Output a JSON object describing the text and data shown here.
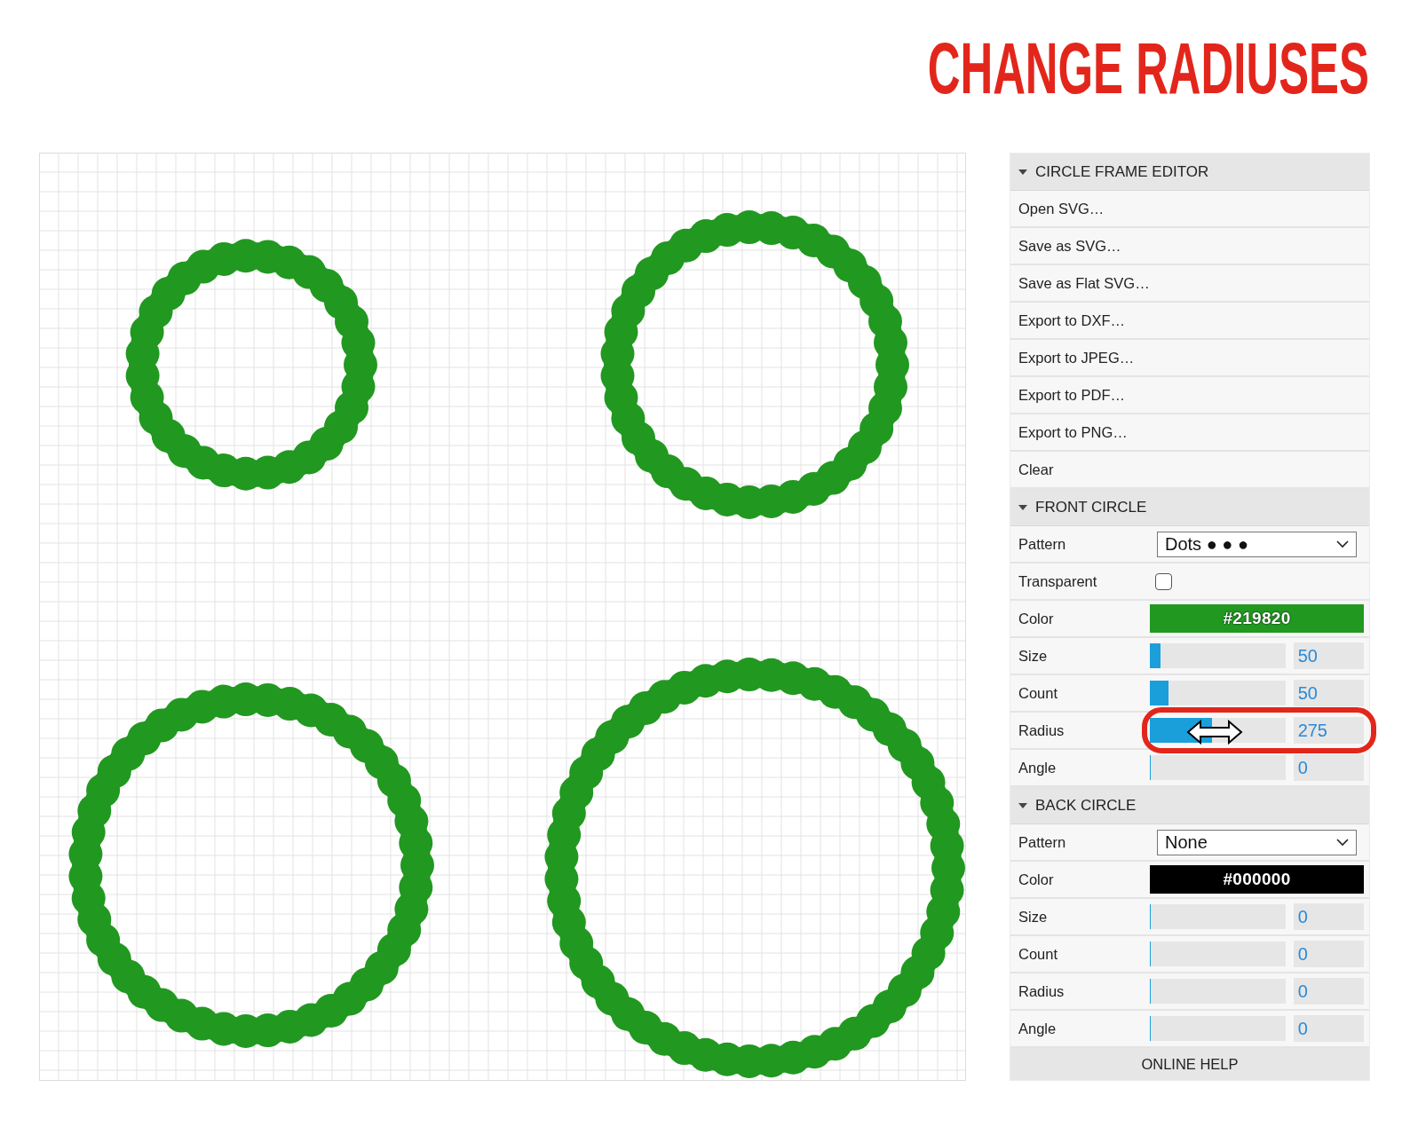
{
  "heading": "CHANGE RADIUSES",
  "sections": [
    {
      "title": "CIRCLE FRAME EDITOR",
      "expanded": true,
      "rows": [
        {
          "kind": "action",
          "label": "Open SVG…"
        },
        {
          "kind": "action",
          "label": "Save as SVG…"
        },
        {
          "kind": "action",
          "label": "Save as Flat SVG…"
        },
        {
          "kind": "action",
          "label": "Export to DXF…"
        },
        {
          "kind": "action",
          "label": "Export to JPEG…"
        },
        {
          "kind": "action",
          "label": "Export to PDF…"
        },
        {
          "kind": "action",
          "label": "Export to PNG…"
        },
        {
          "kind": "action",
          "label": "Clear"
        }
      ]
    },
    {
      "title": "FRONT CIRCLE",
      "expanded": true,
      "rows": [
        {
          "kind": "select",
          "label": "Pattern",
          "value": "Dots ● ● ●"
        },
        {
          "kind": "checkbox",
          "label": "Transparent",
          "checked": false
        },
        {
          "kind": "color",
          "label": "Color",
          "value": "#219820",
          "color": "#219820"
        },
        {
          "kind": "slider",
          "label": "Size",
          "level": 0.08,
          "value": "50",
          "highlighted": false
        },
        {
          "kind": "slider",
          "label": "Count",
          "level": 0.14,
          "value": "50",
          "highlighted": false
        },
        {
          "kind": "slider",
          "label": "Radius",
          "level": 0.46,
          "value": "275",
          "highlighted": true
        },
        {
          "kind": "slider",
          "label": "Angle",
          "level": 0,
          "value": "0",
          "highlighted": false
        }
      ]
    },
    {
      "title": "BACK CIRCLE",
      "expanded": true,
      "rows": [
        {
          "kind": "select",
          "label": "Pattern",
          "value": "None"
        },
        {
          "kind": "color",
          "label": "Color",
          "value": "#000000",
          "color": "#000000"
        },
        {
          "kind": "slider",
          "label": "Size",
          "level": 0,
          "value": "0",
          "highlighted": false
        },
        {
          "kind": "slider",
          "label": "Count",
          "level": 0,
          "value": "0",
          "highlighted": false
        },
        {
          "kind": "slider",
          "label": "Radius",
          "level": 0,
          "value": "0",
          "highlighted": false
        },
        {
          "kind": "slider",
          "label": "Angle",
          "level": 0,
          "value": "0",
          "highlighted": false
        }
      ]
    }
  ],
  "footer": "ONLINE HELP"
}
